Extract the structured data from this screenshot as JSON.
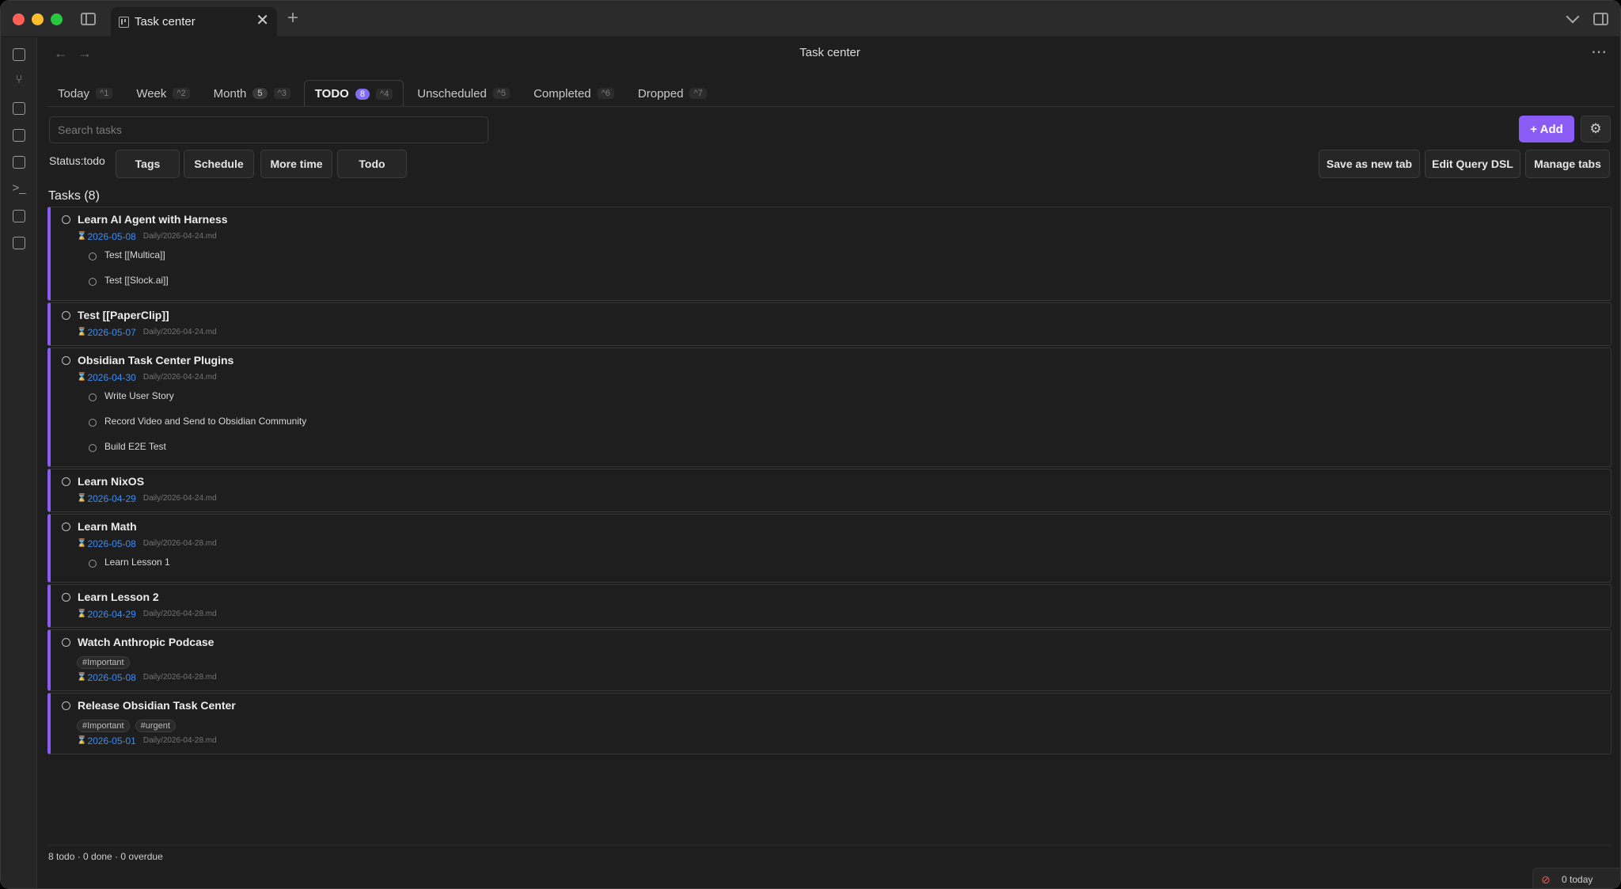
{
  "window": {
    "tab_title": "Task center",
    "close_glyph": "✕",
    "new_tab_glyph": "+"
  },
  "view": {
    "title": "Task center",
    "back_glyph": "←",
    "forward_glyph": "→",
    "more_glyph": "⋯"
  },
  "ribbon_icons": [
    "quick-switcher-icon",
    "graph-icon",
    "canvas-icon",
    "calendar-icon",
    "templates-icon",
    "terminal-icon",
    "task-list-icon",
    "kanban-icon"
  ],
  "tabs": [
    {
      "label": "Today",
      "count": "",
      "key": "^1"
    },
    {
      "label": "Week",
      "count": "",
      "key": "^2"
    },
    {
      "label": "Month",
      "count": "5",
      "key": "^3"
    },
    {
      "label": "TODO",
      "count": "8",
      "key": "^4"
    },
    {
      "label": "Unscheduled",
      "count": "",
      "key": "^5"
    },
    {
      "label": "Completed",
      "count": "",
      "key": "^6"
    },
    {
      "label": "Dropped",
      "count": "",
      "key": "^7"
    }
  ],
  "toolbar": {
    "search_placeholder": "Search tasks",
    "add_label": "+ Add",
    "settings_glyph": "⚙"
  },
  "filters": {
    "status_label": "Status:todo",
    "tags": "Tags",
    "schedule": "Schedule",
    "more_time": "More time",
    "todo": "Todo",
    "save_tab": "Save as new tab",
    "edit_dsl": "Edit Query DSL",
    "manage_tabs": "Manage tabs"
  },
  "list": {
    "title": "Tasks (8)",
    "tasks": [
      {
        "title": "Learn AI Agent with Harness",
        "date": "2026-05-08",
        "file": "Daily/2026-04-24.md",
        "tags": [],
        "subtasks": [
          "Test [[Multica]]",
          "Test [[Slock.ai]]"
        ]
      },
      {
        "title": "Test [[PaperClip]]",
        "date": "2026-05-07",
        "file": "Daily/2026-04-24.md",
        "tags": [],
        "subtasks": []
      },
      {
        "title": "Obsidian Task Center Plugins",
        "date": "2026-04-30",
        "file": "Daily/2026-04-24.md",
        "tags": [],
        "subtasks": [
          "Write User Story",
          "Record Video and Send to Obsidian Community",
          "Build E2E Test"
        ]
      },
      {
        "title": "Learn NixOS",
        "date": "2026-04-29",
        "file": "Daily/2026-04-24.md",
        "tags": [],
        "subtasks": []
      },
      {
        "title": "Learn Math",
        "date": "2026-05-08",
        "file": "Daily/2026-04-28.md",
        "tags": [],
        "subtasks": [
          "Learn Lesson 1"
        ]
      },
      {
        "title": "Learn Lesson 2",
        "date": "2026-04-29",
        "file": "Daily/2026-04-28.md",
        "tags": [],
        "subtasks": []
      },
      {
        "title": "Watch Anthropic Podcase",
        "date": "2026-05-08",
        "file": "Daily/2026-04-28.md",
        "tags": [
          "#Important"
        ],
        "subtasks": []
      },
      {
        "title": "Release Obsidian Task Center",
        "date": "2026-05-01",
        "file": "Daily/2026-04-28.md",
        "tags": [
          "#Important",
          "#urgent"
        ],
        "subtasks": []
      }
    ]
  },
  "footer": {
    "summary": "8 todo · 0 done · 0 overdue"
  },
  "statusbar": {
    "today": "0 today"
  },
  "colors": {
    "accent": "#8a5cf5",
    "date": "#3f8cf0",
    "background": "#1e1e1e"
  }
}
